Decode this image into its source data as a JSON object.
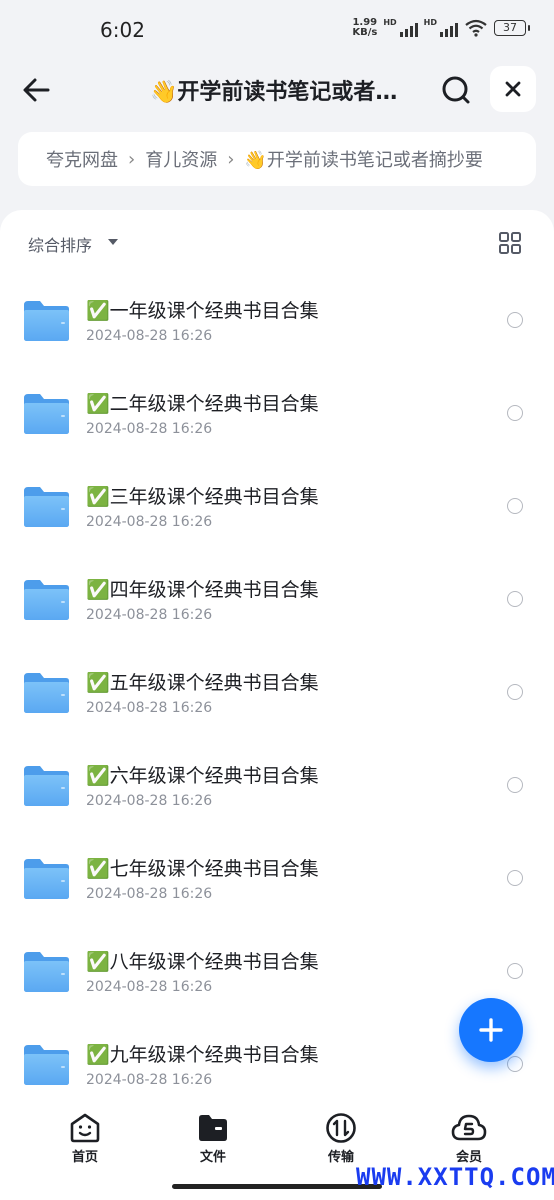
{
  "status": {
    "time": "6:02",
    "net_speed": "1.99",
    "net_unit": "KB/s",
    "hd1": "HD",
    "hd2": "HD",
    "battery": "37"
  },
  "header": {
    "title": "👋开学前读书笔记或者…"
  },
  "breadcrumb": {
    "items": [
      "夸克网盘",
      "育儿资源",
      "👋开学前读书笔记或者摘抄要"
    ],
    "separator": "›"
  },
  "sort": {
    "label": "综合排序"
  },
  "files": [
    {
      "name": "✅一年级课个经典书目合集",
      "date": "2024-08-28 16:26"
    },
    {
      "name": "✅二年级课个经典书目合集",
      "date": "2024-08-28 16:26"
    },
    {
      "name": "✅三年级课个经典书目合集",
      "date": "2024-08-28 16:26"
    },
    {
      "name": "✅四年级课个经典书目合集",
      "date": "2024-08-28 16:26"
    },
    {
      "name": "✅五年级课个经典书目合集",
      "date": "2024-08-28 16:26"
    },
    {
      "name": "✅六年级课个经典书目合集",
      "date": "2024-08-28 16:26"
    },
    {
      "name": "✅七年级课个经典书目合集",
      "date": "2024-08-28 16:26"
    },
    {
      "name": "✅八年级课个经典书目合集",
      "date": "2024-08-28 16:26"
    },
    {
      "name": "✅九年级课个经典书目合集",
      "date": "2024-08-28 16:26"
    }
  ],
  "nav": {
    "items": [
      {
        "label": "首页",
        "icon": "home-face-icon"
      },
      {
        "label": "文件",
        "icon": "folder-icon"
      },
      {
        "label": "传输",
        "icon": "transfer-icon"
      },
      {
        "label": "会员",
        "icon": "member-cloud-icon"
      }
    ],
    "active": "文件"
  },
  "watermark": "WWW.XXTTQ.COM",
  "colors": {
    "accent": "#1677ff",
    "folder": "#6bb6f5",
    "background": "#f2f3f6"
  }
}
